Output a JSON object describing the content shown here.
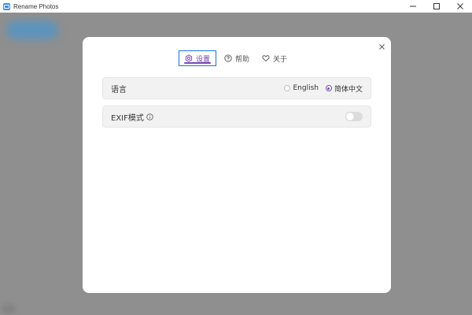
{
  "window": {
    "title": "Rename Photos"
  },
  "dialog": {
    "tabs": [
      {
        "label": "设置",
        "icon": "gear-icon",
        "active": true
      },
      {
        "label": "帮助",
        "icon": "help-icon",
        "active": false
      },
      {
        "label": "关于",
        "icon": "heart-icon",
        "active": false
      }
    ],
    "language": {
      "label": "语言",
      "options": [
        {
          "label": "English",
          "selected": false
        },
        {
          "label": "简体中文",
          "selected": true
        }
      ]
    },
    "exif": {
      "label": "EXIF模式",
      "enabled": false
    }
  },
  "colors": {
    "accent": "#7b49b8",
    "tab_focus_border": "#1a73e8",
    "overlay": "#8f8f8f"
  }
}
